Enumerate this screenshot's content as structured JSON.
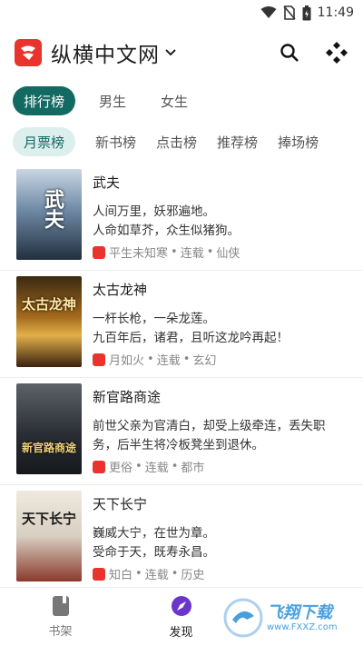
{
  "status": {
    "time": "11:49"
  },
  "header": {
    "title": "纵横中文网"
  },
  "category_tabs": [
    {
      "label": "排行榜"
    },
    {
      "label": "男生"
    },
    {
      "label": "女生"
    }
  ],
  "rank_tabs": [
    {
      "label": "月票榜"
    },
    {
      "label": "新书榜"
    },
    {
      "label": "点击榜"
    },
    {
      "label": "推荐榜"
    },
    {
      "label": "捧场榜"
    }
  ],
  "books": [
    {
      "title": "武夫",
      "cover_text": "武夫",
      "desc1": "人间万里，妖邪遍地。",
      "desc2": "人命如草芥，众生似猪狗。",
      "author": "平生未知寒",
      "status": "连载",
      "genre": "仙侠"
    },
    {
      "title": "太古龙神",
      "cover_text": "太古龙神",
      "desc1": "一杆长枪，一朵龙莲。",
      "desc2": "九百年后，诸君，且听这龙吟再起！",
      "author": "月如火",
      "status": "连载",
      "genre": "玄幻"
    },
    {
      "title": "新官路商途",
      "cover_text": "新官路商途",
      "desc1": "前世父亲为官清白，却受上级牵连，丢失职",
      "desc2": "务，后半生将冷板凳坐到退休。",
      "author": "更俗",
      "status": "连载",
      "genre": "都市"
    },
    {
      "title": "天下长宁",
      "cover_text": "天下长宁",
      "desc1": "巍威大宁，在世为章。",
      "desc2": "受命于天，既寿永昌。",
      "author": "知白",
      "status": "连载",
      "genre": "历史"
    }
  ],
  "meta_sep": "•",
  "bottom_nav": [
    {
      "label": "书架",
      "icon": "bookshelf-icon"
    },
    {
      "label": "发现",
      "icon": "compass-icon"
    }
  ],
  "watermark": {
    "text": "飞翔下载",
    "url": "www.FXXZ.com"
  },
  "colors": {
    "accent": "#136a63",
    "brand_red": "#e8342d",
    "active_nav": "#6a35c8"
  }
}
